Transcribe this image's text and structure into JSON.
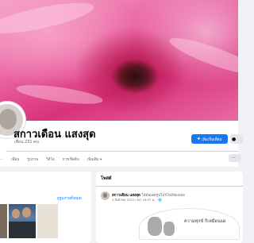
{
  "profile": {
    "name": "สกาวเดือน แสงสุด",
    "friends_text": "เพื่อน 231 คน",
    "add_friend_label": "เพิ่มเป็นเพื่อน",
    "add_friend_icon": "person-plus-icon",
    "message_icon": "messenger-icon"
  },
  "tabs": [
    {
      "label": "…"
    },
    {
      "label": "เพื่อน"
    },
    {
      "label": "รูปภาพ"
    },
    {
      "label": "วิดีโอ"
    },
    {
      "label": "การเช็คอิน"
    },
    {
      "label": "เพิ่มเติม ▾"
    }
  ],
  "more_button": {
    "icon": "ellipsis-icon",
    "label": "···"
  },
  "left_panel": {
    "photos_link": "ดูรูปภาพทั้งหมด"
  },
  "posts": {
    "title": "โพสต์",
    "items": [
      {
        "author": "สกาวเดือน แสงสุด",
        "action": "ได้อัพเดตรูปโปรไฟล์ของเธอ",
        "time": "1 สิงหาคม 2021 เวลา 16:37 น. · 🌐",
        "image_caption": "ความทุกข์ ก็เหมือนแผ"
      }
    ]
  },
  "colors": {
    "accent": "#1877f2",
    "cover_primary": "#d8337c",
    "background": "#f0f2f5"
  }
}
